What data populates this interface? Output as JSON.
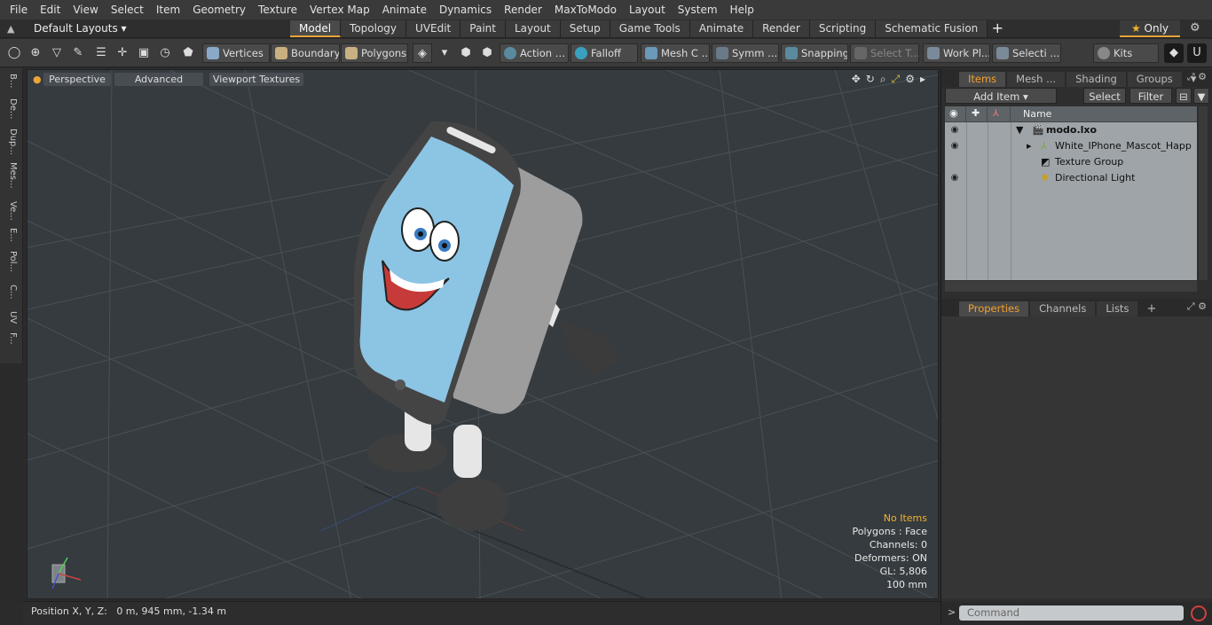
{
  "menu": [
    "File",
    "Edit",
    "View",
    "Select",
    "Item",
    "Geometry",
    "Texture",
    "Vertex Map",
    "Animate",
    "Dynamics",
    "Render",
    "MaxToModo",
    "Layout",
    "System",
    "Help"
  ],
  "layout": {
    "current": "Default Layouts",
    "tabs": [
      "Model",
      "Topology",
      "UVEdit",
      "Paint",
      "Layout",
      "Setup",
      "Game Tools",
      "Animate",
      "Render",
      "Scripting",
      "Schematic Fusion"
    ],
    "active_tab": "Model",
    "only": "Only"
  },
  "toolbar": {
    "vertices": "Vertices",
    "boundary": "Boundary",
    "polygons": "Polygons",
    "action": "Action",
    "falloff": "Falloff",
    "mesh": "Mesh C ...",
    "symm": "Symm ...",
    "snapping": "Snapping",
    "select_t": "Select T...",
    "work_pl": "Work Pl...",
    "selecti": "Selecti ...",
    "kits": "Kits"
  },
  "left_tabs": [
    "B...",
    "De...",
    "Dup...",
    "Mes...",
    "Ve...",
    "E...",
    "Pol...",
    "C...",
    "UV",
    "F..."
  ],
  "viewport": {
    "view": "Perspective",
    "shading": "Advanced",
    "textures": "Viewport Textures",
    "info": {
      "no_items": "No Items",
      "polygons": "Polygons : Face",
      "channels": "Channels: 0",
      "deformers": "Deformers: ON",
      "gl": "GL: 5,806",
      "scale": "100 mm"
    }
  },
  "status": {
    "label": "Position X, Y, Z:",
    "value": "0 m, 945 mm, -1.34 m"
  },
  "items_panel": {
    "tabs": [
      "Items",
      "Mesh ...",
      "Shading",
      "Groups"
    ],
    "active": "Items",
    "add_item": "Add Item",
    "select": "Select",
    "filter": "Filter",
    "col_name": "Name",
    "tree": [
      {
        "label": "modo.lxo",
        "level": 0
      },
      {
        "label": "White_IPhone_Mascot_Happ ...",
        "level": 1
      },
      {
        "label": "Texture Group",
        "level": 1
      },
      {
        "label": "Directional Light",
        "level": 1
      }
    ]
  },
  "props_panel": {
    "tabs": [
      "Properties",
      "Channels",
      "Lists"
    ],
    "active": "Properties"
  },
  "command": {
    "placeholder": "Command"
  }
}
